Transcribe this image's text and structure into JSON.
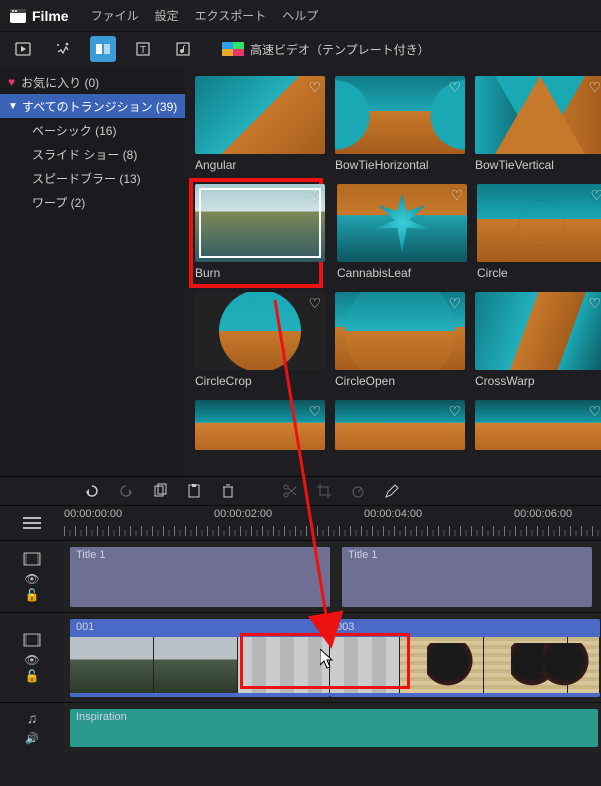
{
  "app": {
    "name": "Filme"
  },
  "menu": {
    "file": "ファイル",
    "settings": "設定",
    "export": "エクスポート",
    "help": "ヘルプ"
  },
  "toolbar": {
    "fast_template_label": "高速ビデオ（テンプレート付き）"
  },
  "sidebar": {
    "favorites": "お気に入り (0)",
    "all_transitions": "すべてのトランジション (39)",
    "items": [
      {
        "label": "ベーシック (16)"
      },
      {
        "label": "スライド ショー (8)"
      },
      {
        "label": "スピードブラー (13)"
      },
      {
        "label": "ワープ (2)"
      }
    ]
  },
  "gallery": {
    "items": [
      {
        "label": "Angular"
      },
      {
        "label": "BowTieHorizontal"
      },
      {
        "label": "BowTieVertical"
      },
      {
        "label": "Burn"
      },
      {
        "label": "CannabisLeaf"
      },
      {
        "label": "Circle"
      },
      {
        "label": "CircleCrop"
      },
      {
        "label": "CircleOpen"
      },
      {
        "label": "CrossWarp"
      },
      {
        "label": ""
      },
      {
        "label": ""
      },
      {
        "label": ""
      }
    ]
  },
  "timeline": {
    "timecodes": [
      "00:00:00:00",
      "00:00:02:00",
      "00:00:04:00",
      "00:00:06:00"
    ],
    "title_clip_1": "Title 1",
    "title_clip_2": "Title 1",
    "video_clip_1": "001",
    "video_clip_2": "003",
    "audio_clip_1": "Inspiration"
  }
}
